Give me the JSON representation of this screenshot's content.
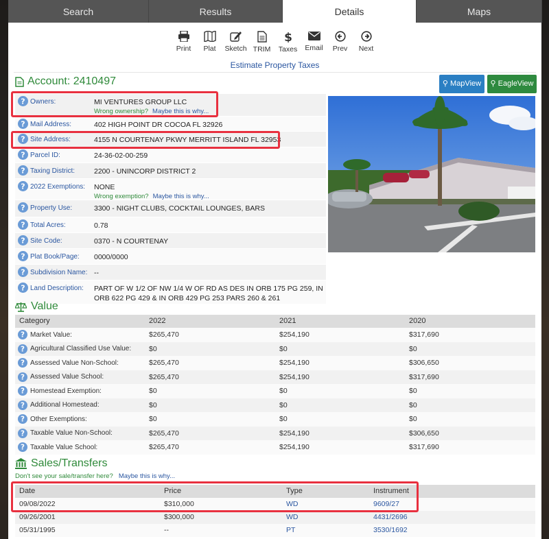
{
  "tabs": [
    "Search",
    "Results",
    "Details",
    "Maps"
  ],
  "toolbar": [
    {
      "label": "Print",
      "icon": "print-icon"
    },
    {
      "label": "Plat",
      "icon": "map-icon"
    },
    {
      "label": "Sketch",
      "icon": "pencil-icon"
    },
    {
      "label": "TRIM",
      "icon": "document-icon"
    },
    {
      "label": "Taxes",
      "icon": "dollar-icon"
    },
    {
      "label": "Email",
      "icon": "envelope-icon"
    },
    {
      "label": "Prev",
      "icon": "arrow-left-icon"
    },
    {
      "label": "Next",
      "icon": "arrow-right-icon"
    }
  ],
  "estimate_link": "Estimate Property Taxes",
  "account": {
    "title": "Account: 2410497"
  },
  "buttons": {
    "mapview": "MapView",
    "eagleview": "EagleView"
  },
  "info": [
    {
      "label": "Owners:",
      "value": "MI VENTURES GROUP LLC",
      "sub": "Wrong ownership?",
      "sub_link": "Maybe this is why..."
    },
    {
      "label": "Mail Address:",
      "value": "402 HIGH POINT DR COCOA FL 32926"
    },
    {
      "label": "Site Address:",
      "value": "4155 N COURTENAY PKWY MERRITT ISLAND FL 32953"
    },
    {
      "label": "Parcel ID:",
      "value": "24-36-02-00-259"
    },
    {
      "label": "Taxing District:",
      "value": "2200 - UNINCORP DISTRICT 2"
    },
    {
      "label": "2022 Exemptions:",
      "value": "NONE",
      "sub": "Wrong exemption?",
      "sub_link": "Maybe this is why..."
    },
    {
      "label": "Property Use:",
      "value": "3300 - NIGHT CLUBS, COCKTAIL LOUNGES, BARS"
    },
    {
      "label": "Total Acres:",
      "value": "0.78"
    },
    {
      "label": "Site Code:",
      "value": "0370 - N COURTENAY"
    },
    {
      "label": "Plat Book/Page:",
      "value": "0000/0000"
    },
    {
      "label": "Subdivision Name:",
      "value": "--"
    },
    {
      "label": "Land Description:",
      "value": "PART OF W 1/2 OF NW 1/4 W OF RD AS DES IN ORB 175 PG 259, IN ORB 622 PG 429 & IN ORB 429 PG 253 PARS 260 & 261"
    }
  ],
  "value_section": {
    "title": "Value",
    "headers": [
      "Category",
      "2022",
      "2021",
      "2020"
    ],
    "rows": [
      [
        "Market Value:",
        "$265,470",
        "$254,190",
        "$317,690"
      ],
      [
        "Agricultural Classified Use Value:",
        "$0",
        "$0",
        "$0"
      ],
      [
        "Assessed Value Non-School:",
        "$265,470",
        "$254,190",
        "$306,650"
      ],
      [
        "Assessed Value School:",
        "$265,470",
        "$254,190",
        "$317,690"
      ],
      [
        "Homestead Exemption:",
        "$0",
        "$0",
        "$0"
      ],
      [
        "Additional Homestead:",
        "$0",
        "$0",
        "$0"
      ],
      [
        "Other Exemptions:",
        "$0",
        "$0",
        "$0"
      ],
      [
        "Taxable Value Non-School:",
        "$265,470",
        "$254,190",
        "$306,650"
      ],
      [
        "Taxable Value School:",
        "$265,470",
        "$254,190",
        "$317,690"
      ]
    ]
  },
  "sales_section": {
    "title": "Sales/Transfers",
    "note": "Don't see your sale/transfer here?",
    "note_link": "Maybe this is why...",
    "headers": [
      "Date",
      "Price",
      "Type",
      "Instrument"
    ],
    "rows": [
      [
        "09/08/2022",
        "$310,000",
        "WD",
        "9609/27"
      ],
      [
        "09/26/2001",
        "$300,000",
        "WD",
        "4431/2696"
      ],
      [
        "05/31/1995",
        "--",
        "PT",
        "3530/1692"
      ]
    ]
  },
  "colors": {
    "accent_green": "#2f8a3a",
    "link_blue": "#2a56a0",
    "highlight_red": "#e8303f"
  }
}
